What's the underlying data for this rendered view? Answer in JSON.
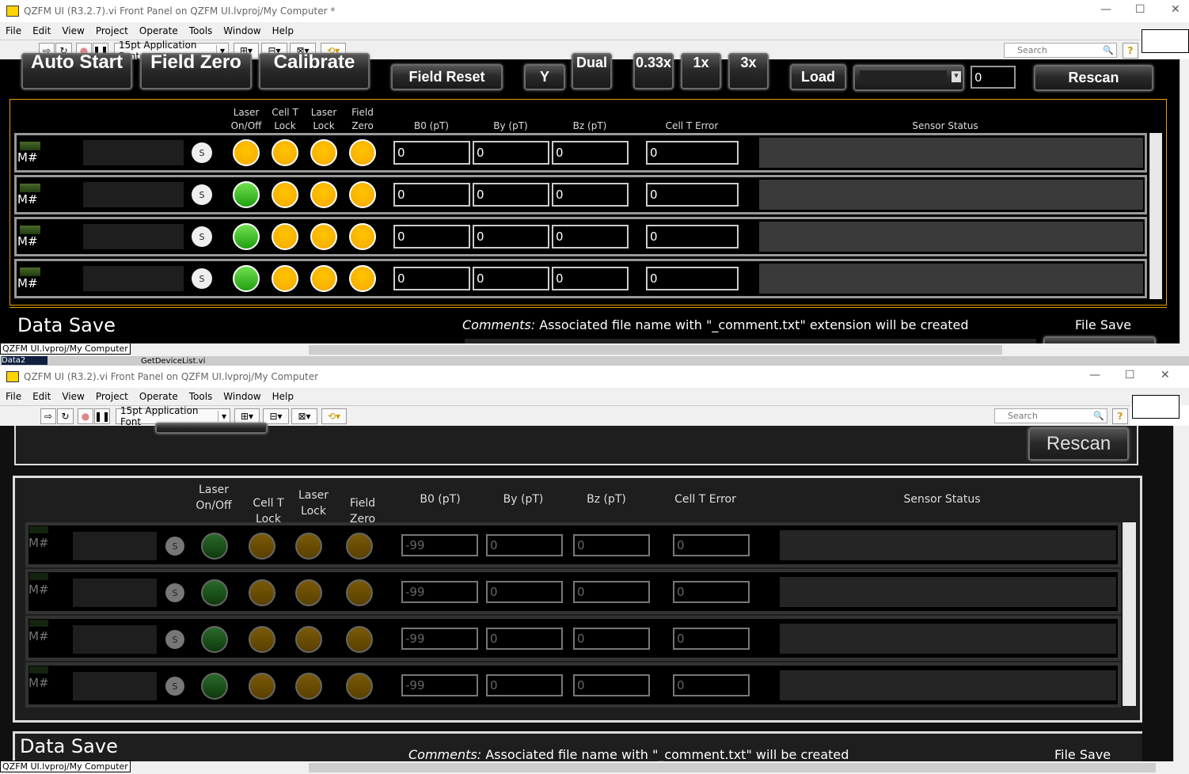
{
  "windows": [
    {
      "title": "QZFM UI (R3.2.7).vi Front Panel on QZFM UI.lvproj/My Computer *",
      "menu": [
        "File",
        "Edit",
        "View",
        "Project",
        "Operate",
        "Tools",
        "Window",
        "Help"
      ],
      "font": "15pt Application Font",
      "search_placeholder": "Search",
      "status_path": "QZFM UI.lvproj/My Computer",
      "buttons": {
        "auto_start": "Auto Start",
        "field_zero": "Field Zero",
        "calibrate": "Calibrate",
        "field_reset": "Field Reset",
        "y": "Y",
        "dual": "Dual",
        "x033": "0.33x",
        "x1": "1x",
        "x3": "3x",
        "load": "Load",
        "rescan": "Rescan"
      },
      "load_index": "0",
      "headers": {
        "laser_onoff": "Laser On/Off",
        "cellt_lock": "Cell T Lock",
        "laser_lock": "Laser Lock",
        "field_zero": "Field Zero",
        "b0": "B0 (pT)",
        "by": "By (pT)",
        "bz": "Bz (pT)",
        "cellt_error": "Cell T Error",
        "sensor_status": "Sensor Status"
      },
      "rows": [
        {
          "label": "M#",
          "s": "S",
          "leds": [
            "orange",
            "orange",
            "orange",
            "orange"
          ],
          "b0": "0",
          "by": "0",
          "bz": "0",
          "err": "0"
        },
        {
          "label": "M#",
          "s": "S",
          "leds": [
            "green",
            "orange",
            "orange",
            "orange"
          ],
          "b0": "0",
          "by": "0",
          "bz": "0",
          "err": "0"
        },
        {
          "label": "M#",
          "s": "S",
          "leds": [
            "green",
            "orange",
            "orange",
            "orange"
          ],
          "b0": "0",
          "by": "0",
          "bz": "0",
          "err": "0"
        },
        {
          "label": "M#",
          "s": "S",
          "leds": [
            "green",
            "orange",
            "orange",
            "orange"
          ],
          "b0": "0",
          "by": "0",
          "bz": "0",
          "err": "0"
        }
      ],
      "data_save": "Data Save",
      "comments_label": "Comments:",
      "comments_text": " Associated file name with \"_comment.txt\" extension will be created",
      "file_save": "File Save"
    },
    {
      "title": "QZFM UI (R3.2).vi Front Panel on QZFM UI.lvproj/My Computer",
      "menu": [
        "File",
        "Edit",
        "View",
        "Project",
        "Operate",
        "Tools",
        "Window",
        "Help"
      ],
      "font": "15pt Application Font",
      "search_placeholder": "Search",
      "status_path": "QZFM UI.lvproj/My Computer",
      "buttons": {
        "rescan": "Rescan"
      },
      "headers": {
        "laser_onoff": "Laser On/Off",
        "cellt_lock": "Cell T Lock",
        "laser_lock": "Laser Lock",
        "field_zero": "Field Zero",
        "b0": "B0 (pT)",
        "by": "By (pT)",
        "bz": "Bz (pT)",
        "cellt_error": "Cell T Error",
        "sensor_status": "Sensor Status"
      },
      "rows": [
        {
          "label": "M#",
          "s": "S",
          "leds": [
            "dkgreen",
            "dkorange",
            "dkorange",
            "dkorange"
          ],
          "b0": "-99",
          "by": "0",
          "bz": "0",
          "err": "0"
        },
        {
          "label": "M#",
          "s": "S",
          "leds": [
            "dkgreen",
            "dkorange",
            "dkorange",
            "dkorange"
          ],
          "b0": "-99",
          "by": "0",
          "bz": "0",
          "err": "0"
        },
        {
          "label": "M#",
          "s": "S",
          "leds": [
            "dkgreen",
            "dkorange",
            "dkorange",
            "dkorange"
          ],
          "b0": "-99",
          "by": "0",
          "bz": "0",
          "err": "0"
        },
        {
          "label": "M#",
          "s": "S",
          "leds": [
            "dkgreen",
            "dkorange",
            "dkorange",
            "dkorange"
          ],
          "b0": "-99",
          "by": "0",
          "bz": "0",
          "err": "0"
        }
      ],
      "data_save": "Data Save",
      "comments_label": "Comments:",
      "comments_text": " Associated file name with \"_comment.txt\" will be created",
      "file_save": "File Save"
    }
  ],
  "background_strip": {
    "left": "Data2",
    "file": "GetDeviceList.vi"
  },
  "colors": {
    "orange": "#ffb800",
    "green": "#3cc832",
    "dkgreen": "#1c5a1c",
    "dkorange": "#6e5000",
    "accent_border": "#e8a000"
  }
}
